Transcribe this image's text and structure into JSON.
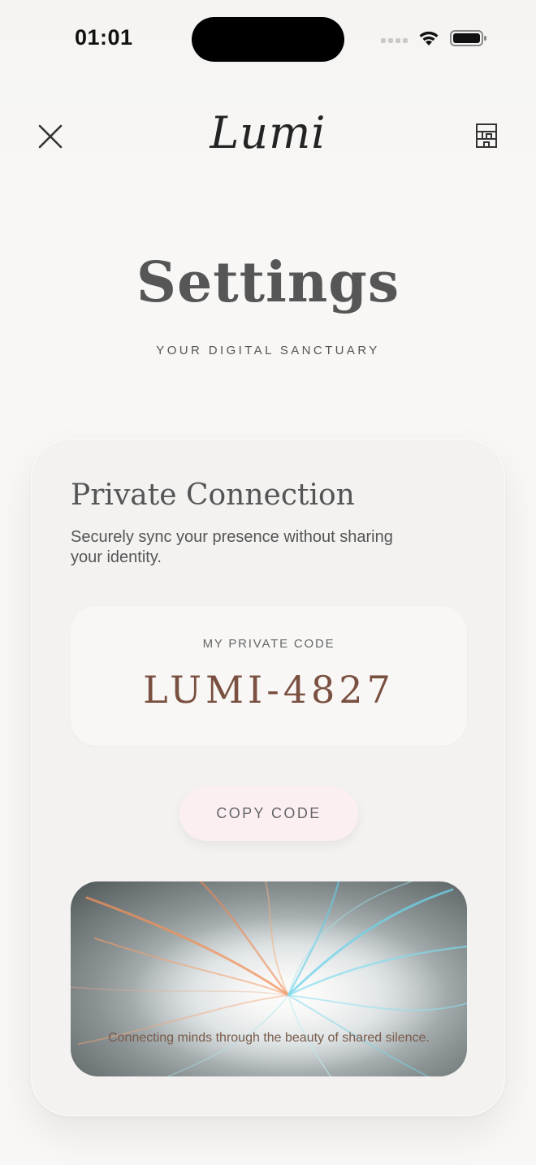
{
  "status_bar": {
    "time": "01:01"
  },
  "header": {
    "brand": "Lumi"
  },
  "page": {
    "title": "Settings",
    "subtitle": "YOUR DIGITAL SANCTUARY"
  },
  "card": {
    "title": "Private Connection",
    "description": "Securely sync your presence without sharing your identity.",
    "code_label": "MY PRIVATE CODE",
    "code_value": "LUMI-4827",
    "copy_button": "COPY CODE",
    "art_caption": "Connecting minds through the beauty of shared silence."
  },
  "colors": {
    "background": "#f8f7f5",
    "code_accent": "#7a5040",
    "copy_button_bg": "#fbeff2",
    "light_orange": "#f0915a",
    "light_cyan": "#6fd3e8"
  },
  "icons": [
    "close-icon",
    "building-icon",
    "wifi-icon",
    "battery-icon",
    "signal-icon"
  ]
}
